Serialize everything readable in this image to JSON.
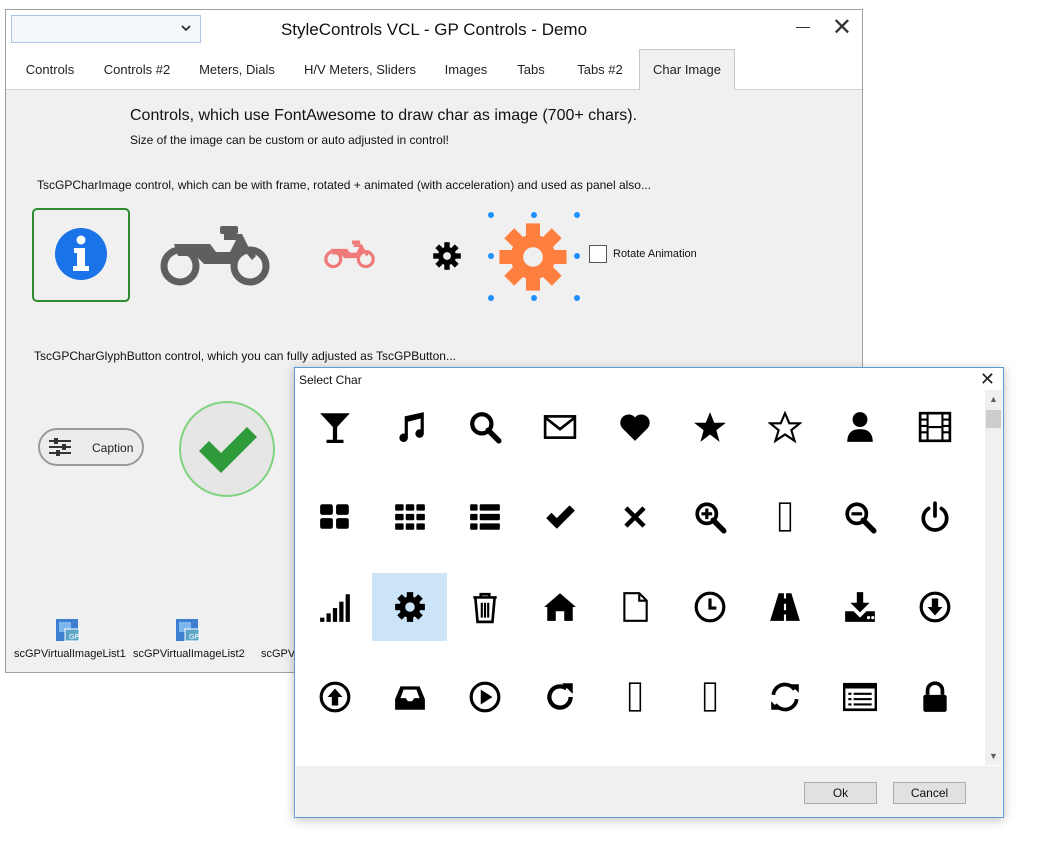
{
  "window": {
    "title": "StyleControls VCL - GP Controls - Demo",
    "close_glyph": "✕",
    "combo_value": ""
  },
  "tabs": [
    {
      "label": "Controls"
    },
    {
      "label": "Controls #2"
    },
    {
      "label": "Meters, Dials"
    },
    {
      "label": "H/V Meters, Sliders"
    },
    {
      "label": "Images"
    },
    {
      "label": "Tabs"
    },
    {
      "label": "Tabs #2"
    },
    {
      "label": "Char Image",
      "active": true
    }
  ],
  "content": {
    "heading": "Controls, which use FontAwesome to draw char as image (700+ chars).",
    "subheading": "Size of the image can be custom or auto adjusted in control!",
    "charimage_caption": "TscGPCharImage control, which can be with frame, rotated + animated (with acceleration) and used as panel also...",
    "rotate_label": "Rotate Animation",
    "glyphbutton_caption": "TscGPCharGlyphButton control, which you can fully adjusted as TscGPButton...",
    "caption_button": "Caption",
    "imagelists": [
      "scGPVirtualImageList1",
      "scGPVirtualImageList2",
      "scGPVi"
    ]
  },
  "colors": {
    "info_blue": "#1a73e8",
    "moto_gray": "#5f5f5f",
    "moto_pink": "#f07a7a",
    "gear_orange": "#ff7f3f",
    "check_green": "#2e9a3a",
    "frame_green": "#2e8b2e",
    "selection_blue": "#cce4f7"
  },
  "dialog": {
    "title": "Select Char",
    "ok_label": "Ok",
    "cancel_label": "Cancel",
    "icons": [
      [
        "cocktail-icon",
        "music-icon",
        "search-icon",
        "envelope-icon",
        "heart-icon",
        "star-icon",
        "star-outline-icon",
        "user-icon",
        "film-icon"
      ],
      [
        "th-large-icon",
        "th-icon",
        "th-list-icon",
        "check-icon",
        "times-icon",
        "zoom-in-icon",
        "missing-glyph-icon",
        "zoom-out-icon",
        "power-icon"
      ],
      [
        "signal-icon",
        "cog-icon",
        "trash-icon",
        "home-icon",
        "file-outline-icon",
        "clock-icon",
        "road-icon",
        "download-icon",
        "arrow-circle-down-icon"
      ],
      [
        "arrow-circle-up-icon",
        "inbox-icon",
        "play-circle-icon",
        "repeat-icon",
        "missing-glyph-icon",
        "missing-glyph-icon",
        "refresh-icon",
        "list-alt-icon",
        "lock-icon"
      ]
    ],
    "selected": "cog-icon"
  }
}
